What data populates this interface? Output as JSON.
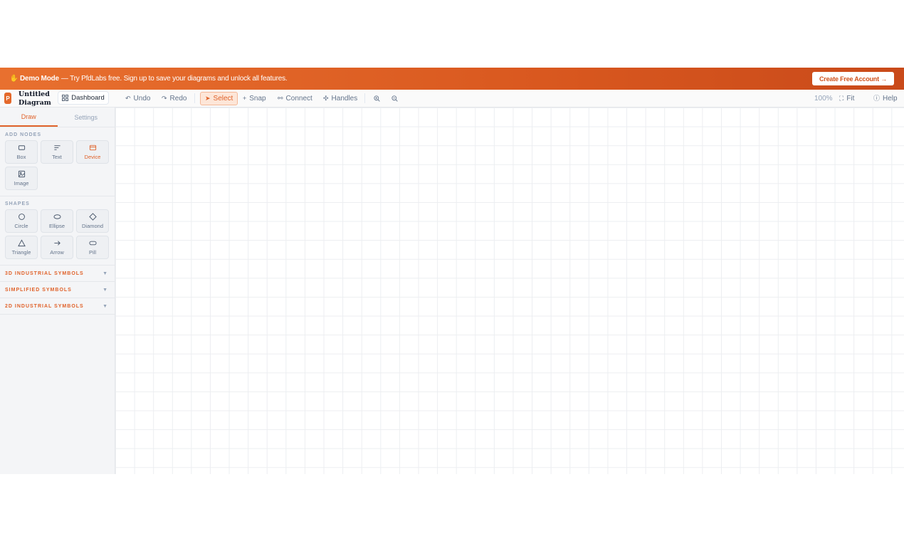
{
  "banner": {
    "icon": "waving-hand-icon",
    "bold": "Demo Mode",
    "text": " — Try PfdLabs free. Sign up to save your diagrams and unlock all features.",
    "cta": "Create Free Account →"
  },
  "toolbar": {
    "logo_letter": "P",
    "title": "Untitled Diagram",
    "dashboard": "Dashboard",
    "undo": "Undo",
    "redo": "Redo",
    "select": "Select",
    "snap": "Snap",
    "connect": "Connect",
    "handles": "Handles",
    "zoom": "100%",
    "fit": "Fit",
    "help": "Help"
  },
  "sidebar": {
    "tabs": [
      "Draw",
      "Settings"
    ],
    "add_nodes_title": "ADD NODES",
    "add_nodes": [
      "Box",
      "Text",
      "Device",
      "Image"
    ],
    "shapes_title": "SHAPES",
    "shapes": [
      "Circle",
      "Ellipse",
      "Diamond",
      "Triangle",
      "Arrow",
      "Pill"
    ],
    "sections": [
      "3D INDUSTRIAL SYMBOLS",
      "SIMPLIFIED SYMBOLS",
      "2D INDUSTRIAL SYMBOLS"
    ]
  },
  "colors": {
    "accent": "#e0622a",
    "banner_start": "#e8702f",
    "banner_end": "#c94a1a"
  }
}
